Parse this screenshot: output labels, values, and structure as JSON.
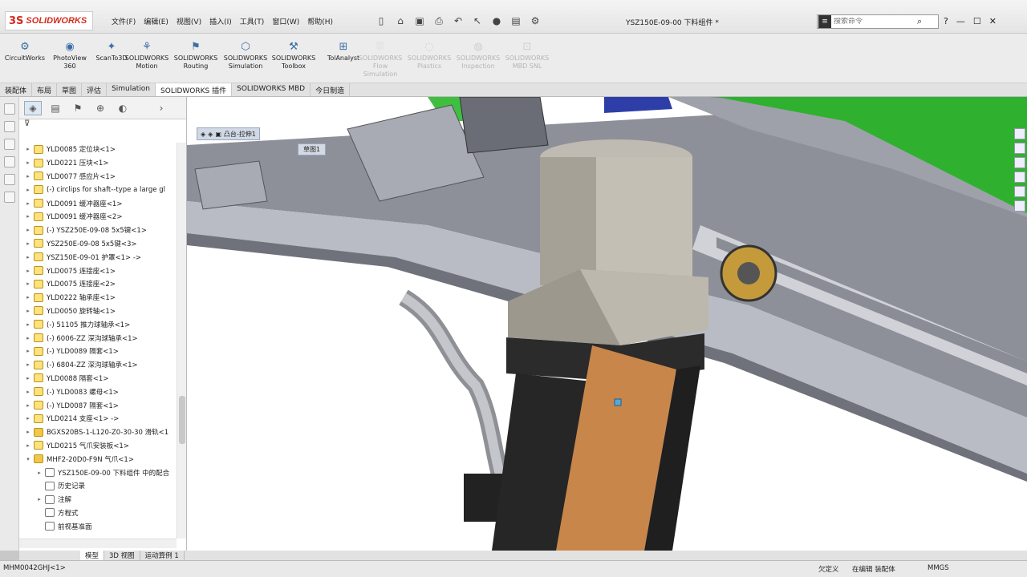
{
  "app": {
    "logo_text": "SOLIDWORKS",
    "doc_title": "YSZ150E-09-00 下料组件 *"
  },
  "menus": [
    "文件(F)",
    "编辑(E)",
    "视图(V)",
    "插入(I)",
    "工具(T)",
    "窗口(W)",
    "帮助(H)"
  ],
  "search": {
    "placeholder": "搜索命令"
  },
  "window_buttons": [
    "?",
    "—",
    "☐",
    "✕"
  ],
  "ribbon": [
    {
      "label": "CircuitWorks",
      "enabled": true
    },
    {
      "label": "PhotoView 360",
      "enabled": true
    },
    {
      "label": "ScanTo3D",
      "enabled": true
    },
    {
      "label": "SOLIDWORKS Motion",
      "enabled": true
    },
    {
      "label": "SOLIDWORKS Routing",
      "enabled": true
    },
    {
      "label": "SOLIDWORKS Simulation",
      "enabled": true
    },
    {
      "label": "SOLIDWORKS Toolbox",
      "enabled": true
    },
    {
      "label": "TolAnalyst",
      "enabled": true
    },
    {
      "label": "SOLIDWORKS Flow Simulation",
      "enabled": false
    },
    {
      "label": "SOLIDWORKS Plastics",
      "enabled": false
    },
    {
      "label": "SOLIDWORKS Inspection",
      "enabled": false
    },
    {
      "label": "SOLIDWORKS MBD SNL",
      "enabled": false
    }
  ],
  "tabs": [
    "装配体",
    "布局",
    "草图",
    "评估",
    "Simulation",
    "SOLIDWORKS 插件",
    "SOLIDWORKS MBD",
    "今日制造"
  ],
  "active_tab": "SOLIDWORKS 插件",
  "tree": [
    {
      "label": "YLD0085 定位块<1>",
      "type": "part",
      "toggle": "▸"
    },
    {
      "label": "YLD0221 压块<1>",
      "type": "part",
      "toggle": "▸"
    },
    {
      "label": "YLD0077 感应片<1>",
      "type": "part",
      "toggle": "▸"
    },
    {
      "label": "(-) circlips for shaft--type a large gl",
      "type": "part",
      "toggle": "▸"
    },
    {
      "label": "YLD0091 缓冲器座<1>",
      "type": "part",
      "toggle": "▸"
    },
    {
      "label": "YLD0091 缓冲器座<2>",
      "type": "part",
      "toggle": "▸"
    },
    {
      "label": "(-) YSZ250E-09-08 5x5键<1>",
      "type": "part",
      "toggle": "▸"
    },
    {
      "label": "YSZ250E-09-08 5x5键<3>",
      "type": "part",
      "toggle": "▸"
    },
    {
      "label": "YSZ150E-09-01 护罩<1> ->",
      "type": "part",
      "toggle": "▸"
    },
    {
      "label": "YLD0075 连接座<1>",
      "type": "part",
      "toggle": "▸"
    },
    {
      "label": "YLD0075 连接座<2>",
      "type": "part",
      "toggle": "▸"
    },
    {
      "label": "YLD0222 轴承座<1>",
      "type": "part",
      "toggle": "▸"
    },
    {
      "label": "YLD0050 旋转轴<1>",
      "type": "part",
      "toggle": "▸"
    },
    {
      "label": "(-) 51105 推力球轴承<1>",
      "type": "part",
      "toggle": "▸"
    },
    {
      "label": "(-) 6006-ZZ 深沟球轴承<1>",
      "type": "part",
      "toggle": "▸"
    },
    {
      "label": "(-) YLD0089 隔套<1>",
      "type": "part",
      "toggle": "▸"
    },
    {
      "label": "(-) 6804-ZZ 深沟球轴承<1>",
      "type": "part",
      "toggle": "▸"
    },
    {
      "label": "YLD0088 隔套<1>",
      "type": "part",
      "toggle": "▸"
    },
    {
      "label": "(-) YLD0083 螺母<1>",
      "type": "part",
      "toggle": "▸"
    },
    {
      "label": "(-) YLD0087 隔套<1>",
      "type": "part",
      "toggle": "▸"
    },
    {
      "label": "YLD0214 支座<1> ->",
      "type": "part",
      "toggle": "▸"
    },
    {
      "label": "BGXS20BS-1-L120-Z0-30-30 滑轨<1",
      "type": "asm",
      "toggle": "▸"
    },
    {
      "label": "YLD0215 气爪安装板<1>",
      "type": "part",
      "toggle": "▸"
    },
    {
      "label": "MHF2-20D0-F9N 气爪<1>",
      "type": "asm",
      "toggle": "▾"
    },
    {
      "label": "YSZ150E-09-00 下料组件 中的配合",
      "type": "feat",
      "toggle": "▸",
      "indent": 1
    },
    {
      "label": "历史记录",
      "type": "feat",
      "toggle": "",
      "indent": 1
    },
    {
      "label": "注解",
      "type": "feat",
      "toggle": "▸",
      "indent": 1
    },
    {
      "label": "方程式",
      "type": "feat",
      "toggle": "",
      "indent": 1
    },
    {
      "label": "前视基准面",
      "type": "feat",
      "toggle": "",
      "indent": 1
    }
  ],
  "viewport": {
    "overlay_label": "凸台-拉伸1",
    "sub_label": "草图1"
  },
  "bottom_tabs": [
    "模型",
    "3D 视图",
    "运动算例 1"
  ],
  "active_bottom_tab": "模型",
  "status": {
    "left": "MHM0042GHJ<1>",
    "defined": "欠定义",
    "editing": "在编辑 装配体",
    "units": "MMGS"
  },
  "colors": {
    "accent": "#d52b1e",
    "motor_orange": "#c8864a",
    "frame_gray": "#a8abb4",
    "green_panel": "#2fb12f"
  }
}
